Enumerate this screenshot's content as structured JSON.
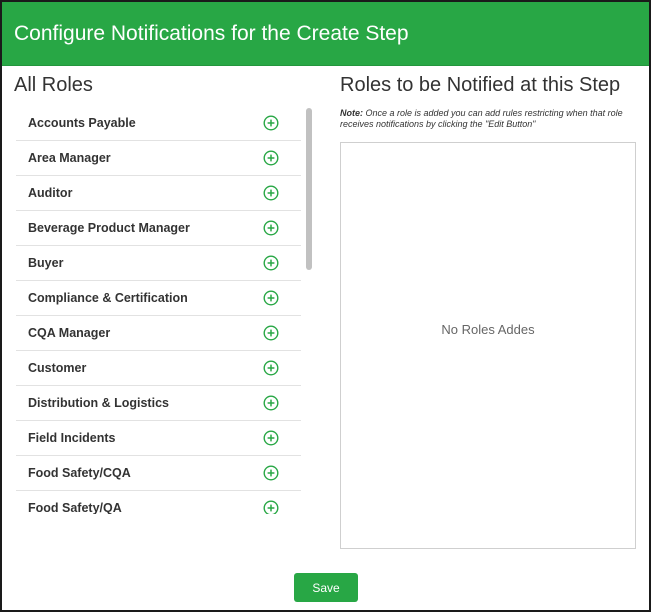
{
  "dialog": {
    "title": "Configure Notifications for the Create Step"
  },
  "all_roles": {
    "title": "All Roles",
    "add_icon": "plus-circle-icon",
    "items": [
      {
        "label": "Accounts Payable"
      },
      {
        "label": "Area Manager"
      },
      {
        "label": "Auditor"
      },
      {
        "label": "Beverage Product Manager"
      },
      {
        "label": "Buyer"
      },
      {
        "label": "Compliance & Certification"
      },
      {
        "label": "CQA Manager"
      },
      {
        "label": "Customer"
      },
      {
        "label": "Distribution & Logistics"
      },
      {
        "label": "Field Incidents"
      },
      {
        "label": "Food Safety/CQA"
      },
      {
        "label": "Food Safety/QA"
      }
    ]
  },
  "notified": {
    "title": "Roles to be Notified at this Step",
    "note_label": "Note:",
    "note_text": " Once a role is added you can add rules restricting when that role receives notifications by clicking the \"Edit Button\"",
    "empty_text": "No Roles Addes"
  },
  "footer": {
    "save_label": "Save"
  },
  "colors": {
    "brand_green": "#28a745",
    "text": "#333333",
    "divider": "#e2e2e2"
  }
}
